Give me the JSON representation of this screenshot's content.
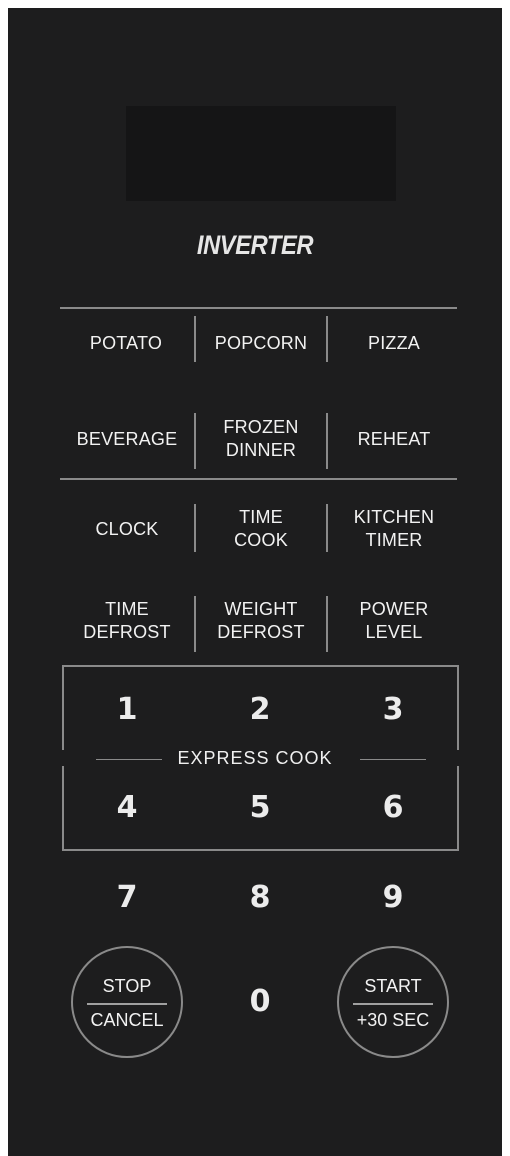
{
  "brand": "INVERTER",
  "row1": {
    "potato": "POTATO",
    "popcorn": "POPCORN",
    "pizza": "PIZZA"
  },
  "row2": {
    "beverage": "BEVERAGE",
    "frozen_dinner": [
      "FROZEN",
      "DINNER"
    ],
    "reheat": "REHEAT"
  },
  "row3": {
    "clock": "CLOCK",
    "time_cook": [
      "TIME",
      "COOK"
    ],
    "kitchen_timer": [
      "KITCHEN",
      "TIMER"
    ]
  },
  "row4": {
    "time_defrost": [
      "TIME",
      "DEFROST"
    ],
    "weight_defrost": [
      "WEIGHT",
      "DEFROST"
    ],
    "power_level": [
      "POWER",
      "LEVEL"
    ]
  },
  "express_cook": "EXPRESS COOK",
  "digits": [
    "1",
    "2",
    "3",
    "4",
    "5",
    "6",
    "7",
    "8",
    "9",
    "0"
  ],
  "stop_cancel": [
    "STOP",
    "CANCEL"
  ],
  "start_30sec": [
    "START",
    "+30 SEC"
  ],
  "colors": {
    "panel": "#1d1d1e",
    "display": "#151516",
    "lines": "#8a8a8a",
    "text": "#f0f0f0"
  }
}
